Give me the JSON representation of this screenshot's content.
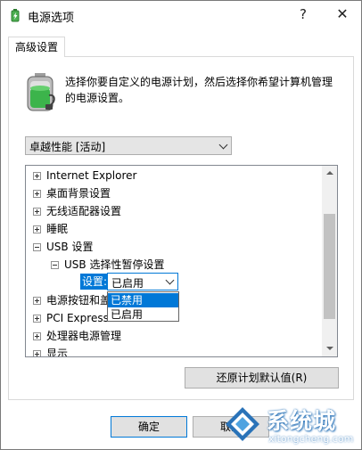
{
  "window": {
    "title": "电源选项",
    "help_button": "?",
    "close_button": "✕"
  },
  "tab": {
    "label": "高级设置"
  },
  "description": {
    "line1": "选择你要自定义的电源计划，然后选择你希望计算机管理",
    "line2": "的电源设置。"
  },
  "plan_select": {
    "value": "卓越性能 [活动]"
  },
  "tree": {
    "items": [
      {
        "label": "Internet Explorer"
      },
      {
        "label": "桌面背景设置"
      },
      {
        "label": "无线适配器设置"
      },
      {
        "label": "睡眠"
      },
      {
        "label": "USB 设置"
      },
      {
        "label": "USB 选择性暂停设置"
      },
      {
        "label": "电源按钮和盖"
      },
      {
        "label": "PCI Express"
      },
      {
        "label": "处理器电源管理"
      },
      {
        "label": "显示"
      }
    ],
    "setting_label": "设置:",
    "setting_value": "已启用",
    "dropdown_options": [
      {
        "label": "已禁用",
        "selected": true
      },
      {
        "label": "已启用",
        "selected": false
      }
    ]
  },
  "buttons": {
    "restore": "还原计划默认值(R)",
    "ok": "确定",
    "cancel": "取消"
  },
  "watermark": {
    "name": "系统城",
    "url": "xitongcheng.com"
  },
  "colors": {
    "accent": "#0078d7",
    "battery_green": "#3cb44b"
  },
  "icons": {
    "app": "power-options-icon",
    "header": "battery-icon"
  }
}
